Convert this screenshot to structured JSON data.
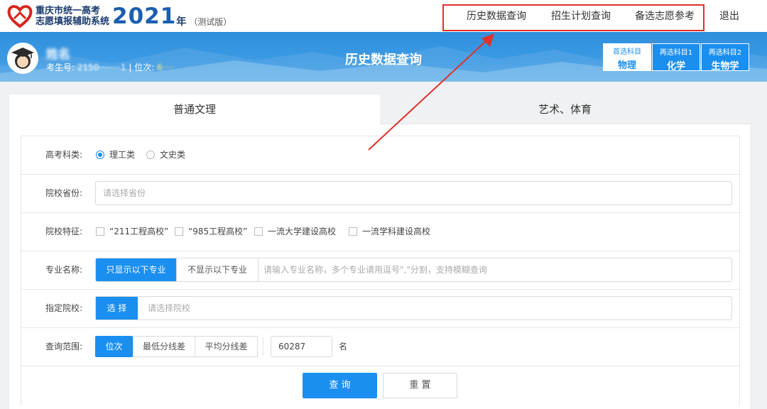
{
  "header": {
    "logo_line1": "重庆市统一高考",
    "logo_line2": "志愿填报辅助系统",
    "logo_year": "2021",
    "logo_nian": "年",
    "logo_test": "（测试版）",
    "nav": [
      "历史数据查询",
      "招生计划查询",
      "备选志愿参考"
    ],
    "logout": "退出"
  },
  "banner": {
    "name": "姓名",
    "student_id_label": "考生号:",
    "student_id": "2150········1",
    "rank_label": "位次:",
    "rank": "6····",
    "title": "历史数据查询",
    "subjects": [
      {
        "label": "首选科目",
        "value": "物理"
      },
      {
        "label": "再选科目1",
        "value": "化学"
      },
      {
        "label": "再选科目2",
        "value": "生物学"
      }
    ]
  },
  "tabs": [
    "普通文理",
    "艺术、体育"
  ],
  "form": {
    "category": {
      "label": "高考科类:",
      "options": [
        "理工类",
        "文史类"
      ],
      "selected": "理工类"
    },
    "province": {
      "label": "院校省份:",
      "placeholder": "请选择省份"
    },
    "features": {
      "label": "院校特征:",
      "options": [
        "“211工程高校”",
        "“985工程高校”",
        "一流大学建设高校",
        "一流学科建设高校"
      ]
    },
    "major": {
      "label": "专业名称:",
      "show_btn": "只显示以下专业",
      "hide_btn": "不显示以下专业",
      "placeholder": "请输入专业名称，多个专业请用逗号\",\"分割，支持模糊查询"
    },
    "school": {
      "label": "指定院校:",
      "select_btn": "选 择",
      "placeholder": "请选择院校"
    },
    "range": {
      "label": "查询范围:",
      "options": [
        "位次",
        "最低分线差",
        "平均分线差"
      ],
      "value": "60287",
      "unit": "名"
    },
    "query_btn": "查 询",
    "reset_btn": "重 置"
  },
  "colors": {
    "accent": "#1a8ff0",
    "annotation": "#e0312c",
    "banner": "#3d9be4"
  }
}
